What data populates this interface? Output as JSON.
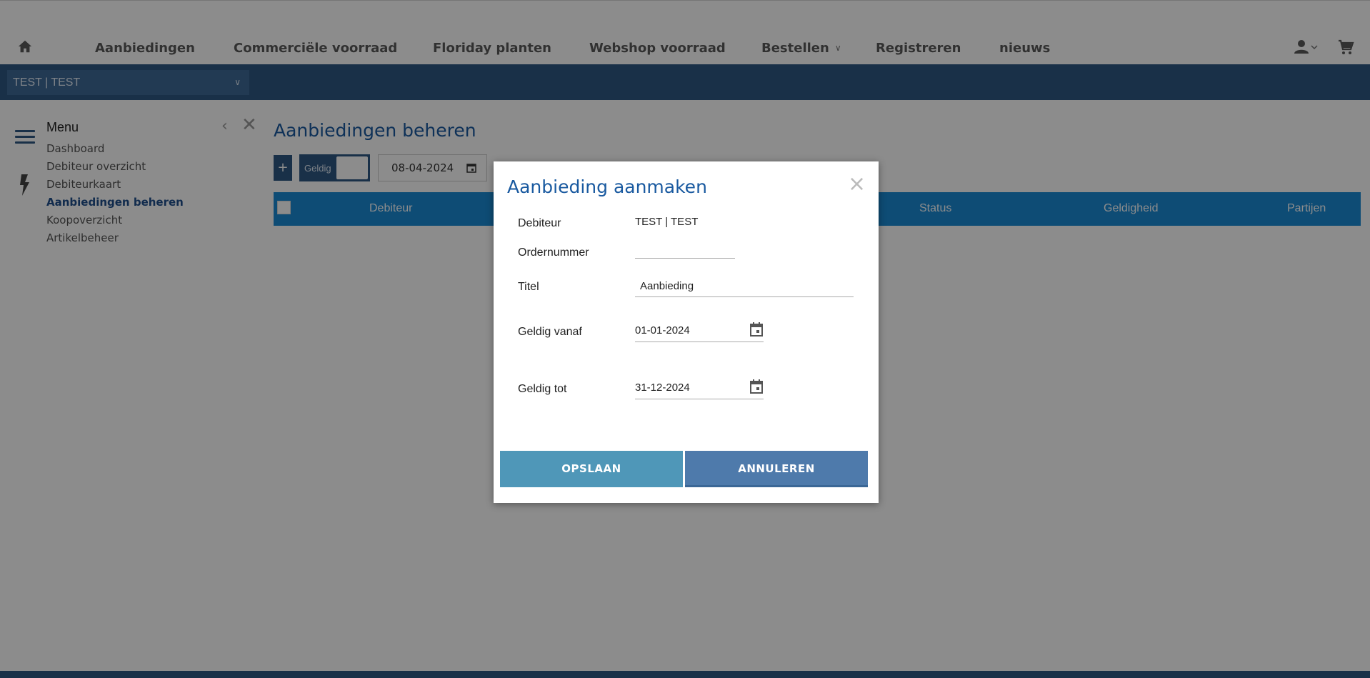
{
  "topnav": {
    "items": [
      "Aanbiedingen",
      "Commerciële voorraad",
      "Floriday planten",
      "Webshop voorraad",
      "Bestellen",
      "Registreren",
      "nieuws"
    ]
  },
  "customer_selector": {
    "value": "TEST | TEST"
  },
  "sidebar": {
    "title": "Menu",
    "items": [
      "Dashboard",
      "Debiteur overzicht",
      "Debiteurkaart",
      "Aanbiedingen beheren",
      "Koopoverzicht",
      "Artikelbeheer"
    ],
    "active_item": "Aanbiedingen beheren"
  },
  "main": {
    "title": "Aanbiedingen beheren",
    "toolbar": {
      "add_label": "+",
      "toggle_label": "Geldig",
      "date": "08-04-2024"
    },
    "table_columns": [
      "Debiteur",
      "Status",
      "Geldigheid",
      "Partijen"
    ]
  },
  "modal": {
    "title": "Aanbieding aanmaken",
    "close_glyph": "×",
    "labels": {
      "debiteur": "Debiteur",
      "ordernummer": "Ordernummer",
      "titel": "Titel",
      "geldig_vanaf": "Geldig vanaf",
      "geldig_tot": "Geldig tot"
    },
    "values": {
      "debiteur": "TEST | TEST",
      "ordernummer": "",
      "titel": "Aanbieding",
      "geldig_vanaf": "01-01-2024",
      "geldig_tot": "31-12-2024"
    },
    "buttons": {
      "save": "OPSLAAN",
      "cancel": "ANNULEREN"
    }
  },
  "colors": {
    "brand_blue": "#2f5883",
    "table_header": "#1a8ad6",
    "title_blue": "#1a5aa0",
    "save_button": "#4f97b8",
    "cancel_button": "#4e7aab"
  }
}
